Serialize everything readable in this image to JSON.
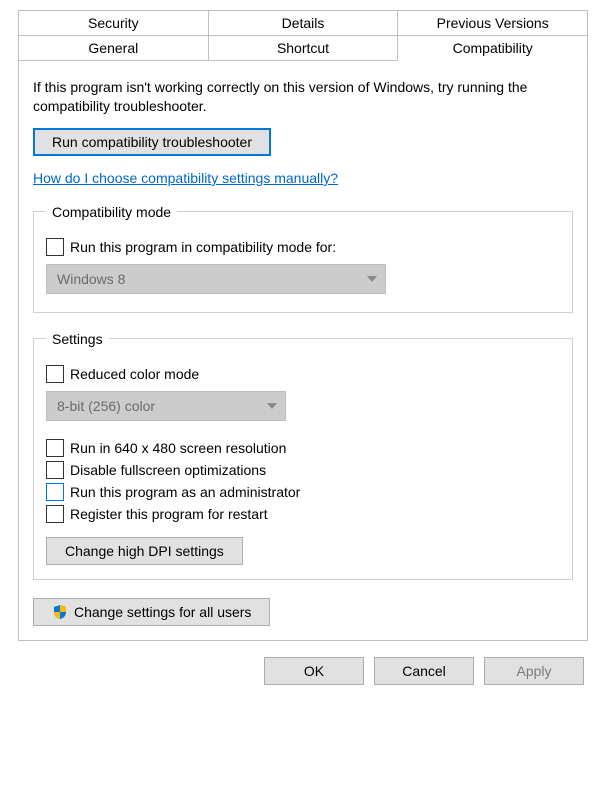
{
  "tabs": {
    "row1": [
      "Security",
      "Details",
      "Previous Versions"
    ],
    "row2": [
      "General",
      "Shortcut",
      "Compatibility"
    ],
    "active": "Compatibility"
  },
  "intro": "If this program isn't working correctly on this version of Windows, try running the compatibility troubleshooter.",
  "run_troubleshooter": "Run compatibility troubleshooter",
  "help_link": "How do I choose compatibility settings manually?",
  "compat_mode": {
    "legend": "Compatibility mode",
    "checkbox": "Run this program in compatibility mode for:",
    "select_value": "Windows 8"
  },
  "settings": {
    "legend": "Settings",
    "reduced_color": "Reduced color mode",
    "color_select": "8-bit (256) color",
    "run_640": "Run in 640 x 480 screen resolution",
    "disable_fullscreen": "Disable fullscreen optimizations",
    "run_admin": "Run this program as an administrator",
    "register_restart": "Register this program for restart",
    "high_dpi": "Change high DPI settings"
  },
  "change_all_users": "Change settings for all users",
  "footer": {
    "ok": "OK",
    "cancel": "Cancel",
    "apply": "Apply"
  }
}
